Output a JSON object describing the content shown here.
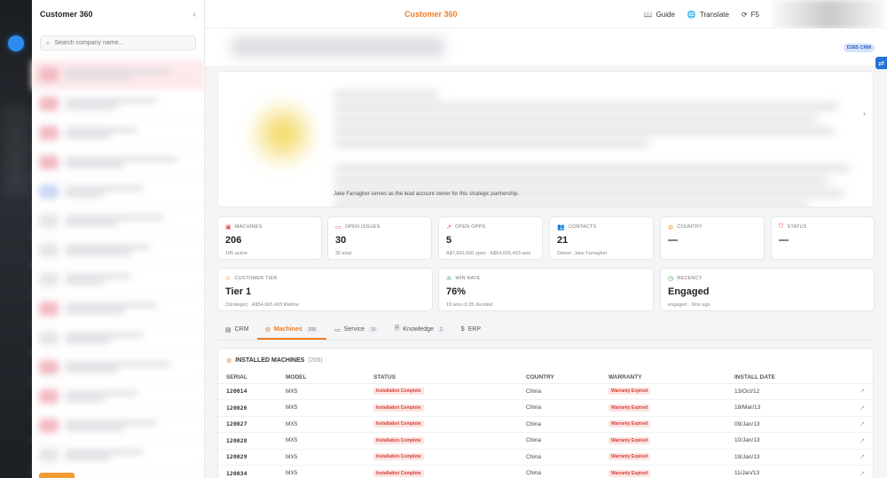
{
  "app": {
    "title": "Customer 360"
  },
  "sidebar": {
    "title": "Customer 360",
    "search_placeholder": "Search company name..."
  },
  "topbar": {
    "guide": "Guide",
    "translate": "Translate",
    "refresh": "F5"
  },
  "badge": "D365 CRM",
  "overview": {
    "last_line": "Jake Farragher serves as the lead account owner for this strategic partnership."
  },
  "stats": {
    "machines": {
      "label": "Machines",
      "value": "206",
      "sub": "195 active"
    },
    "open_issues": {
      "label": "Open Issues",
      "value": "30",
      "sub": "35 total"
    },
    "open_opps": {
      "label": "Open Opps",
      "value": "5",
      "sub": "A$7,600,000 open · A$54,665,493 won"
    },
    "contacts": {
      "label": "Contacts",
      "value": "21",
      "sub": "Owner: Jake Farragher"
    },
    "country": {
      "label": "Country",
      "value": "—"
    },
    "status": {
      "label": "Status",
      "value": "—"
    },
    "tier": {
      "label": "Customer Tier",
      "value": "Tier 1",
      "sub": "(Strategic) · A$54,665,493 lifetime"
    },
    "win_rate": {
      "label": "Win Rate",
      "value": "76%",
      "sub": "19 won of 25 decided"
    },
    "recency": {
      "label": "Recency",
      "value": "Engaged",
      "sub": "engaged · 3mo ago"
    }
  },
  "tabs": [
    {
      "label": "CRM",
      "count": ""
    },
    {
      "label": "Machines",
      "count": "206"
    },
    {
      "label": "Service",
      "count": "31"
    },
    {
      "label": "Knowledge",
      "count": "2"
    },
    {
      "label": "ERP",
      "count": ""
    }
  ],
  "machines": {
    "title": "INSTALLED MACHINES",
    "count": "(206)",
    "columns": [
      "SERIAL",
      "MODEL",
      "STATUS",
      "COUNTRY",
      "WARRANTY",
      "INSTALL DATE"
    ],
    "rows": [
      {
        "serial": "120014",
        "model": "MX5",
        "status": "Installation Complete",
        "country": "China",
        "warranty": "Warranty Expired",
        "date": "13/Oct/12"
      },
      {
        "serial": "120026",
        "model": "MX5",
        "status": "Installation Complete",
        "country": "China",
        "warranty": "Warranty Expired",
        "date": "18/Mar/13"
      },
      {
        "serial": "120027",
        "model": "MX5",
        "status": "Installation Complete",
        "country": "China",
        "warranty": "Warranty Expired",
        "date": "09/Jan/13"
      },
      {
        "serial": "120028",
        "model": "MX5",
        "status": "Installation Complete",
        "country": "China",
        "warranty": "Warranty Expired",
        "date": "10/Jan/13"
      },
      {
        "serial": "120029",
        "model": "MX5",
        "status": "Installation Complete",
        "country": "China",
        "warranty": "Warranty Expired",
        "date": "19/Jan/13"
      },
      {
        "serial": "120034",
        "model": "MX5",
        "status": "Installation Complete",
        "country": "China",
        "warranty": "Warranty Expired",
        "date": "11/Jan/13"
      }
    ]
  },
  "colors": {
    "accent": "#f07d22",
    "danger": "#d9413a",
    "link": "#2374d6"
  }
}
